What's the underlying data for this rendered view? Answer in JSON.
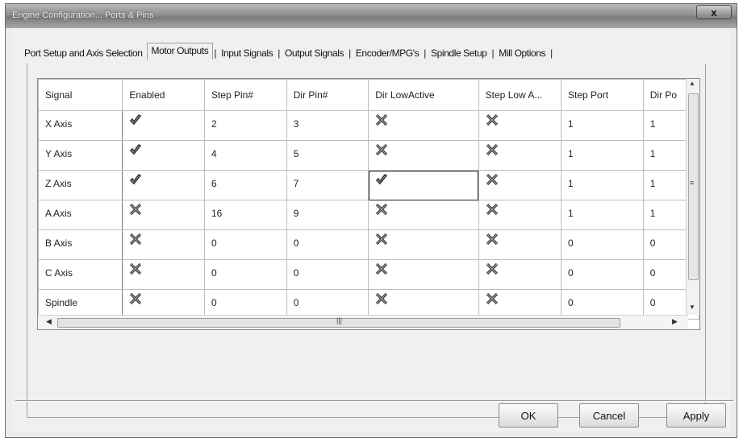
{
  "window": {
    "title": "Engine Configuration... Ports & Pins",
    "close_glyph": "x"
  },
  "tabs": [
    {
      "label": "Port Setup and Axis Selection",
      "selected": false
    },
    {
      "label": "Motor Outputs",
      "selected": true
    },
    {
      "label": "Input Signals",
      "selected": false
    },
    {
      "label": "Output Signals",
      "selected": false
    },
    {
      "label": "Encoder/MPG's",
      "selected": false
    },
    {
      "label": "Spindle Setup",
      "selected": false
    },
    {
      "label": "Mill Options",
      "selected": false
    }
  ],
  "grid": {
    "columns": [
      "Signal",
      "Enabled",
      "Step Pin#",
      "Dir Pin#",
      "Dir LowActive",
      "Step Low A...",
      "Step Port",
      "Dir Po"
    ],
    "rows": [
      {
        "signal": "X Axis",
        "enabled": true,
        "step_pin": "2",
        "dir_pin": "3",
        "dir_low_active": false,
        "step_low_active": false,
        "step_port": "1",
        "dir_port": "1"
      },
      {
        "signal": "Y Axis",
        "enabled": true,
        "step_pin": "4",
        "dir_pin": "5",
        "dir_low_active": false,
        "step_low_active": false,
        "step_port": "1",
        "dir_port": "1"
      },
      {
        "signal": "Z Axis",
        "enabled": true,
        "step_pin": "6",
        "dir_pin": "7",
        "dir_low_active": true,
        "step_low_active": false,
        "step_port": "1",
        "dir_port": "1"
      },
      {
        "signal": "A Axis",
        "enabled": false,
        "step_pin": "16",
        "dir_pin": "9",
        "dir_low_active": false,
        "step_low_active": false,
        "step_port": "1",
        "dir_port": "1"
      },
      {
        "signal": "B Axis",
        "enabled": false,
        "step_pin": "0",
        "dir_pin": "0",
        "dir_low_active": false,
        "step_low_active": false,
        "step_port": "0",
        "dir_port": "0"
      },
      {
        "signal": "C Axis",
        "enabled": false,
        "step_pin": "0",
        "dir_pin": "0",
        "dir_low_active": false,
        "step_low_active": false,
        "step_port": "0",
        "dir_port": "0"
      },
      {
        "signal": "Spindle",
        "enabled": false,
        "step_pin": "0",
        "dir_pin": "0",
        "dir_low_active": false,
        "step_low_active": false,
        "step_port": "0",
        "dir_port": "0"
      }
    ],
    "selected_cell": "Z Axis / Dir LowActive",
    "check_icon": "check-icon",
    "cross_icon": "cross-icon"
  },
  "buttons": {
    "ok": "OK",
    "cancel": "Cancel",
    "apply": "Apply"
  },
  "colors": {
    "titlebar": "#8f8f8f",
    "dialog_bg": "#f0f0f0",
    "grid_bg": "#ffffff"
  }
}
